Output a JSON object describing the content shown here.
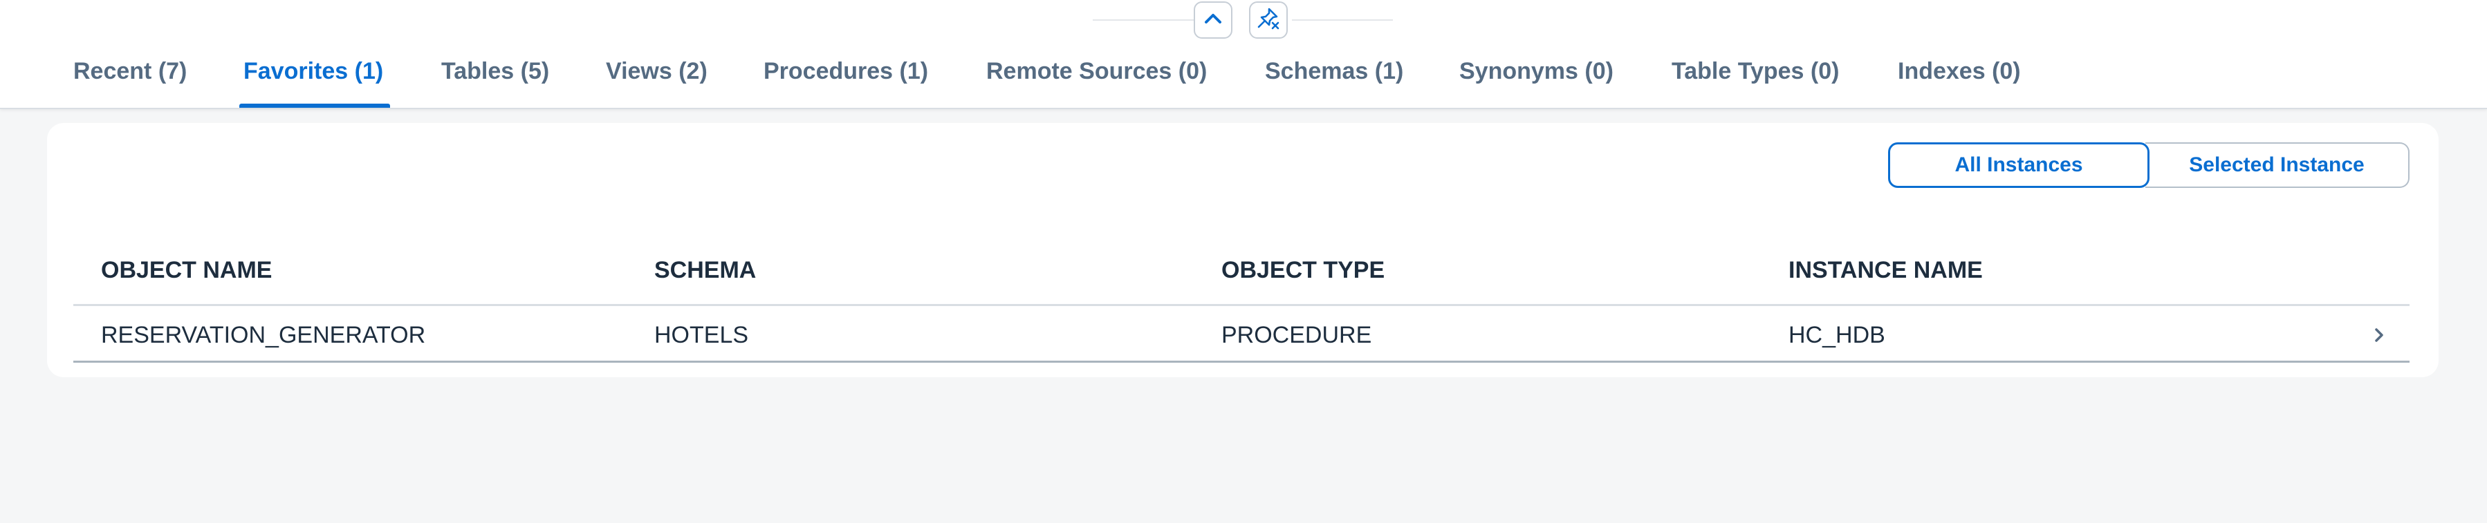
{
  "tabs": [
    {
      "label": "Recent (7)",
      "active": false
    },
    {
      "label": "Favorites (1)",
      "active": true
    },
    {
      "label": "Tables (5)",
      "active": false
    },
    {
      "label": "Views (2)",
      "active": false
    },
    {
      "label": "Procedures (1)",
      "active": false
    },
    {
      "label": "Remote Sources (0)",
      "active": false
    },
    {
      "label": "Schemas (1)",
      "active": false
    },
    {
      "label": "Synonyms (0)",
      "active": false
    },
    {
      "label": "Table Types (0)",
      "active": false
    },
    {
      "label": "Indexes (0)",
      "active": false
    }
  ],
  "segmented": {
    "all": "All Instances",
    "selected": "Selected Instance",
    "active": "All Instances"
  },
  "table": {
    "columns": [
      "OBJECT NAME",
      "SCHEMA",
      "OBJECT TYPE",
      "INSTANCE NAME"
    ],
    "rows": [
      [
        "RESERVATION_GENERATOR",
        "HOTELS",
        "PROCEDURE",
        "HC_HDB"
      ]
    ]
  },
  "icons": {
    "collapse": "chevron-up-icon",
    "unpin": "unpin-icon",
    "row_nav": "chevron-right-icon"
  },
  "colors": {
    "accent": "#0a6ed1",
    "tab_inactive": "#556b82",
    "text": "#1d2d3e",
    "background": "#f5f6f7"
  }
}
